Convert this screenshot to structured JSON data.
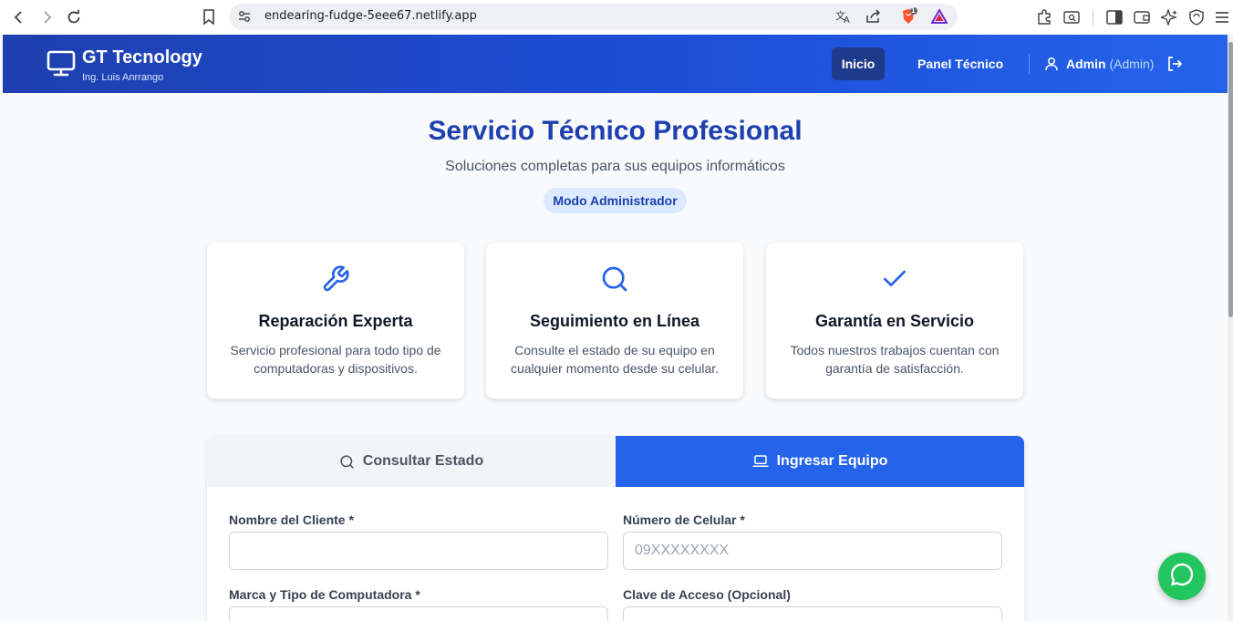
{
  "browser": {
    "url": "endearing-fudge-5eee67.netlify.app",
    "shield_count": "1"
  },
  "header": {
    "brand": "GT Tecnology",
    "subtitle": "Ing. Luis Anrrango",
    "nav": {
      "inicio": "Inicio",
      "panel": "Panel Técnico"
    },
    "user": {
      "name": "Admin",
      "role": "(Admin)"
    }
  },
  "hero": {
    "title": "Servicio Técnico Profesional",
    "subtitle": "Soluciones completas para sus equipos informáticos",
    "badge": "Modo Administrador"
  },
  "features": [
    {
      "icon": "wrench-icon",
      "title": "Reparación Experta",
      "desc": "Servicio profesional para todo tipo de computadoras y dispositivos."
    },
    {
      "icon": "search-icon",
      "title": "Seguimiento en Línea",
      "desc": "Consulte el estado de su equipo en cualquier momento desde su celular."
    },
    {
      "icon": "check-icon",
      "title": "Garantía en Servicio",
      "desc": "Todos nuestros trabajos cuentan con garantía de satisfacción."
    }
  ],
  "tabs": {
    "consultar": "Consultar Estado",
    "ingresar": "Ingresar Equipo"
  },
  "form": {
    "cliente_label": "Nombre del Cliente *",
    "cliente_value": "",
    "celular_label": "Número de Celular *",
    "celular_placeholder": "09XXXXXXXX",
    "marca_label": "Marca y Tipo de Computadora *",
    "clave_label": "Clave de Acceso (Opcional)"
  },
  "colors": {
    "primary": "#2563eb",
    "primary_dark": "#1e40af",
    "whatsapp": "#22c55e"
  }
}
